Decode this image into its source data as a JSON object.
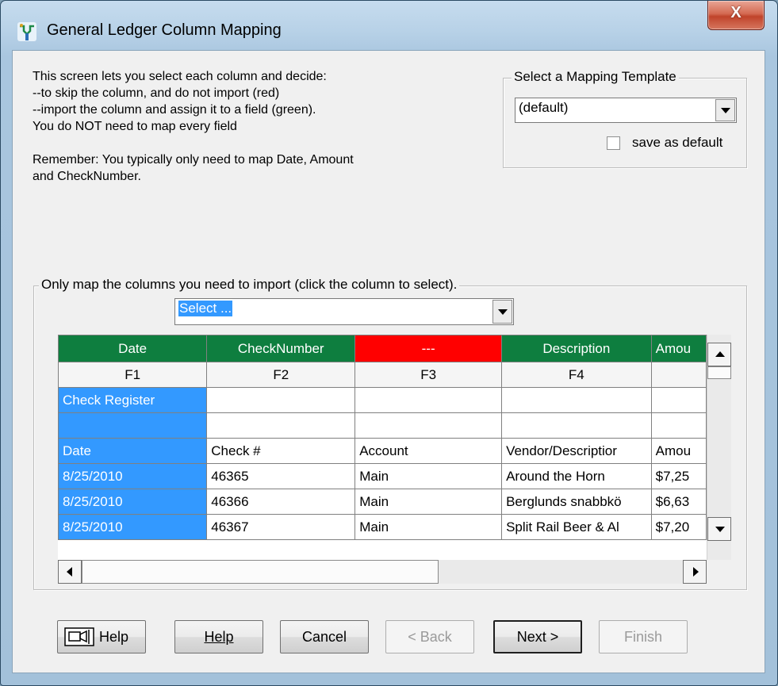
{
  "window": {
    "title": "General Ledger Column Mapping",
    "close_symbol": "X"
  },
  "instructions": {
    "lines": [
      "This screen lets you select each column and decide:",
      "--to skip the column, and do not import (red)",
      "--import the column and assign it to a field (green).",
      "You do NOT need to map every field",
      "",
      "Remember:  You typically only need to map Date, Amount",
      "and CheckNumber."
    ]
  },
  "template_group": {
    "legend": "Select a Mapping Template",
    "selected": "(default)",
    "save_default_label": "save as default",
    "save_default_checked": false
  },
  "mapping_group": {
    "legend": "Only map the columns you need to import (click the column to select).",
    "field_select_value": "Select ..."
  },
  "grid": {
    "mapping_headers": [
      "Date",
      "CheckNumber",
      "---",
      "Description",
      "Amou"
    ],
    "mapping_status": [
      "green",
      "green",
      "red",
      "green",
      "green"
    ],
    "field_headers": [
      "F1",
      "F2",
      "F3",
      "F4",
      ""
    ],
    "rows": [
      [
        "Check Register",
        "",
        "",
        "",
        ""
      ],
      [
        "",
        "",
        "",
        "",
        ""
      ],
      [
        "Date",
        "Check #",
        "Account",
        "Vendor/Descriptior",
        "Amou"
      ],
      [
        "8/25/2010",
        "46365",
        "Main",
        "Around the Horn",
        "$7,25"
      ],
      [
        "8/25/2010",
        "46366",
        "Main",
        "Berglunds snabbkö",
        "$6,63"
      ],
      [
        "8/25/2010",
        "46367",
        "Main",
        "Split Rail Beer & Al",
        "$7,20"
      ]
    ]
  },
  "buttons": {
    "help_icon_label": "Help",
    "help": "Help",
    "cancel": "Cancel",
    "back": "< Back",
    "next": "Next >",
    "finish": "Finish"
  },
  "colors": {
    "green": "#0e7e3f",
    "red": "#ff0000",
    "selection_blue": "#3399ff"
  }
}
